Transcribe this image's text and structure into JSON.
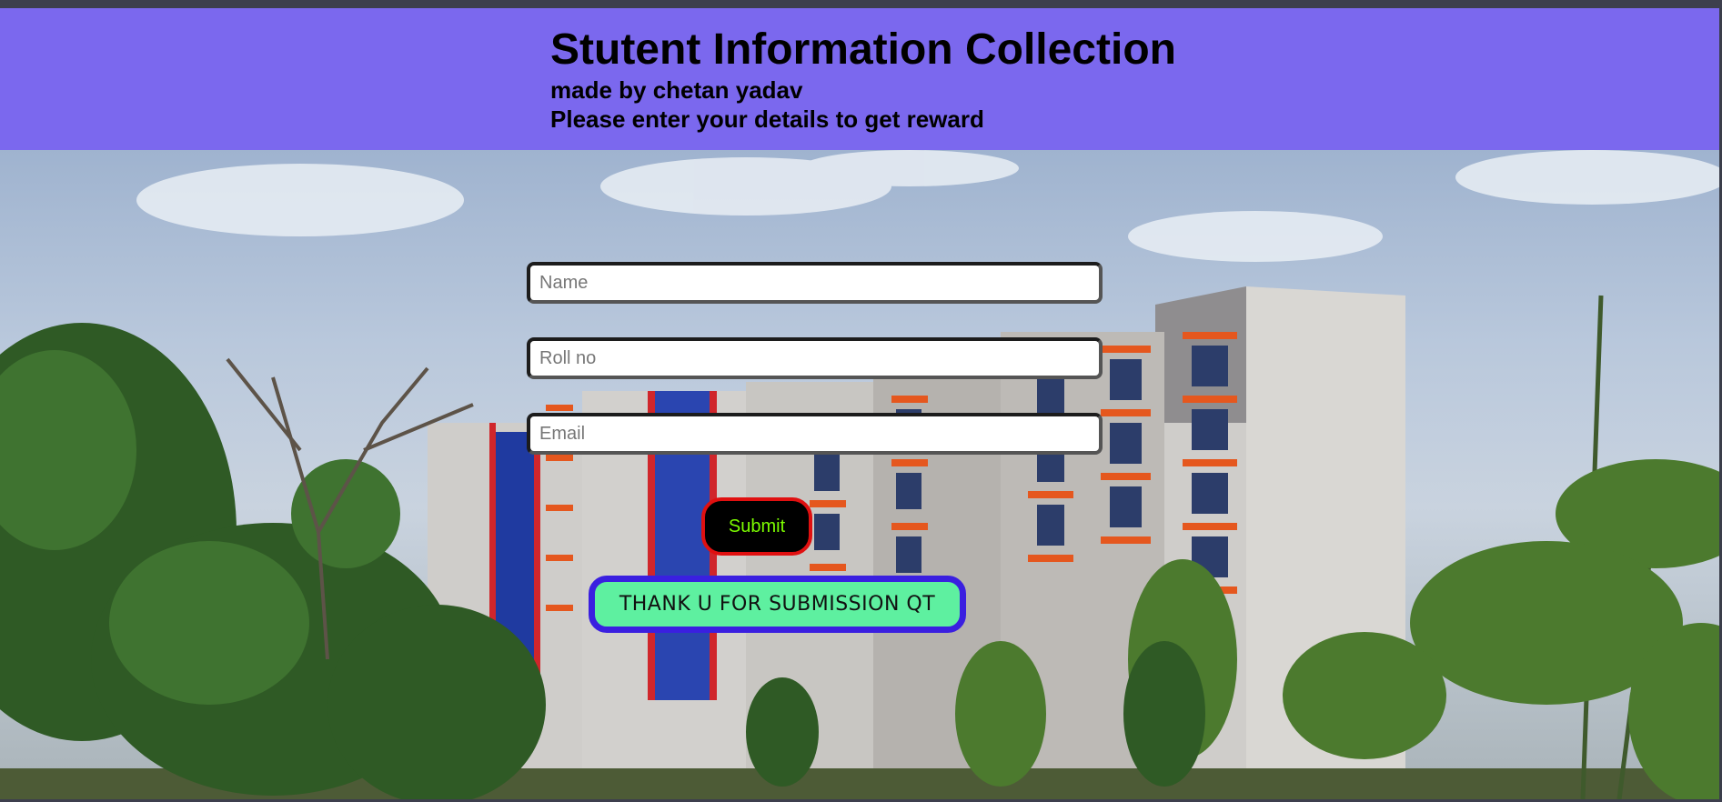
{
  "header": {
    "title": "Stutent Information Collection",
    "author_line": "made by chetan yadav",
    "instruction": "Please enter your details to get reward",
    "bg_color": "#7b68ee"
  },
  "form": {
    "name_placeholder": "Name",
    "roll_placeholder": "Roll no",
    "email_placeholder": "Email",
    "submit_label": "Submit",
    "submit_text_color": "#7cfc00",
    "submit_border_color": "#e01010"
  },
  "thanks_message": {
    "text": "THANK U FOR SUBMISSION QT",
    "bg_color": "#5ef0a0",
    "border_color": "#3a1fe0"
  },
  "background": {
    "image_icon": "college-building-photo"
  }
}
